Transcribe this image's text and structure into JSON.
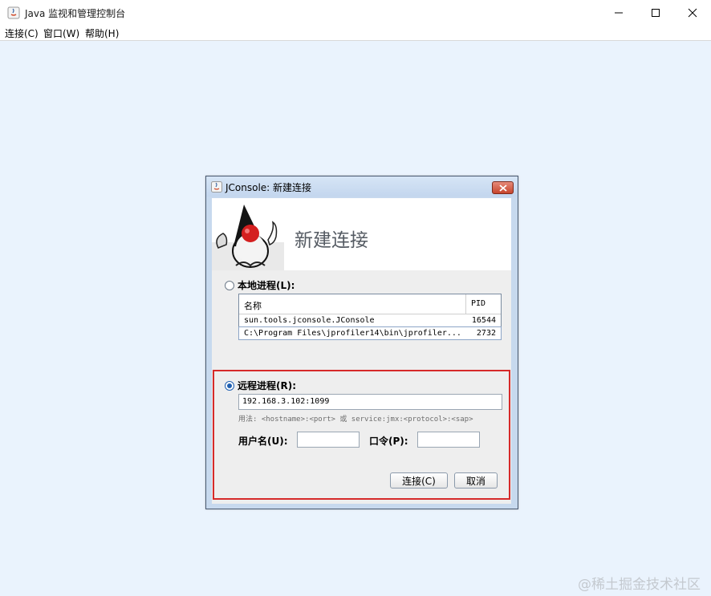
{
  "window": {
    "title": "Java 监视和管理控制台"
  },
  "menu": [
    "连接(C)",
    "窗口(W)",
    "帮助(H)"
  ],
  "dialog": {
    "title": "JConsole: 新建连接",
    "banner_title": "新建连接",
    "local": {
      "label": "本地进程(L):",
      "selected": false,
      "columns": [
        "名称",
        "PID"
      ],
      "rows": [
        {
          "name": "sun.tools.jconsole.JConsole",
          "pid": "16544"
        },
        {
          "name": "C:\\Program Files\\jprofiler14\\bin\\jprofiler...",
          "pid": "2732"
        }
      ]
    },
    "remote": {
      "label": "远程进程(R):",
      "selected": true,
      "value": "192.168.3.102:1099",
      "usage": "用法: <hostname>:<port> 或 service:jmx:<protocol>:<sap>",
      "username_label": "用户名(U):",
      "password_label": "口令(P):",
      "username_value": "",
      "password_value": ""
    },
    "buttons": {
      "connect": "连接(C)",
      "cancel": "取消"
    }
  },
  "watermark": "@稀土掘金技术社区",
  "colors": {
    "highlight_border": "#d62a2a",
    "client_bg": "#eaf3fd",
    "radio_accent": "#1f5fb0"
  }
}
